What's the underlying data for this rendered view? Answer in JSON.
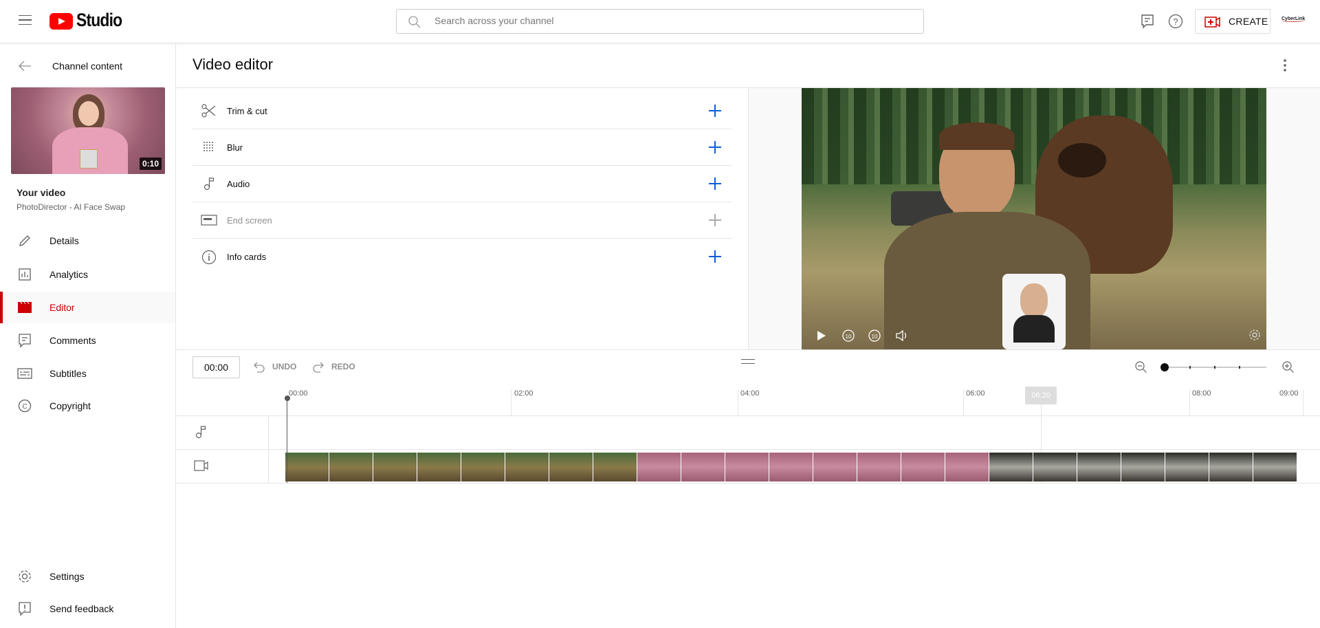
{
  "header": {
    "logo_text": "Studio",
    "search_placeholder": "Search across your channel",
    "create_label": "CREATE",
    "account_logo": "CyberLink"
  },
  "sidebar": {
    "back_label": "Channel content",
    "thumb_duration": "0:10",
    "video_heading": "Your video",
    "video_title": "PhotoDirector - AI Face Swap",
    "items": [
      {
        "label": "Details",
        "icon": "pencil-icon"
      },
      {
        "label": "Analytics",
        "icon": "analytics-icon"
      },
      {
        "label": "Editor",
        "icon": "clapper-icon",
        "active": true
      },
      {
        "label": "Comments",
        "icon": "comments-icon"
      },
      {
        "label": "Subtitles",
        "icon": "subtitles-icon"
      },
      {
        "label": "Copyright",
        "icon": "copyright-icon"
      }
    ],
    "bottom": [
      {
        "label": "Settings",
        "icon": "gear-icon"
      },
      {
        "label": "Send feedback",
        "icon": "feedback-icon"
      }
    ]
  },
  "main": {
    "title": "Video editor",
    "tools": [
      {
        "label": "Trim & cut",
        "icon": "scissors-icon"
      },
      {
        "label": "Blur",
        "icon": "blur-icon"
      },
      {
        "label": "Audio",
        "icon": "music-note-icon"
      },
      {
        "label": "End screen",
        "icon": "end-screen-icon",
        "disabled": true
      },
      {
        "label": "Info cards",
        "icon": "info-icon"
      }
    ]
  },
  "timeline": {
    "current_time": "00:00",
    "undo_label": "UNDO",
    "redo_label": "REDO",
    "hover_time": "06:20",
    "ticks": [
      "00:00",
      "02:00",
      "04:00",
      "06:00",
      "08:00",
      "09:00"
    ],
    "zoom_level": 0
  }
}
